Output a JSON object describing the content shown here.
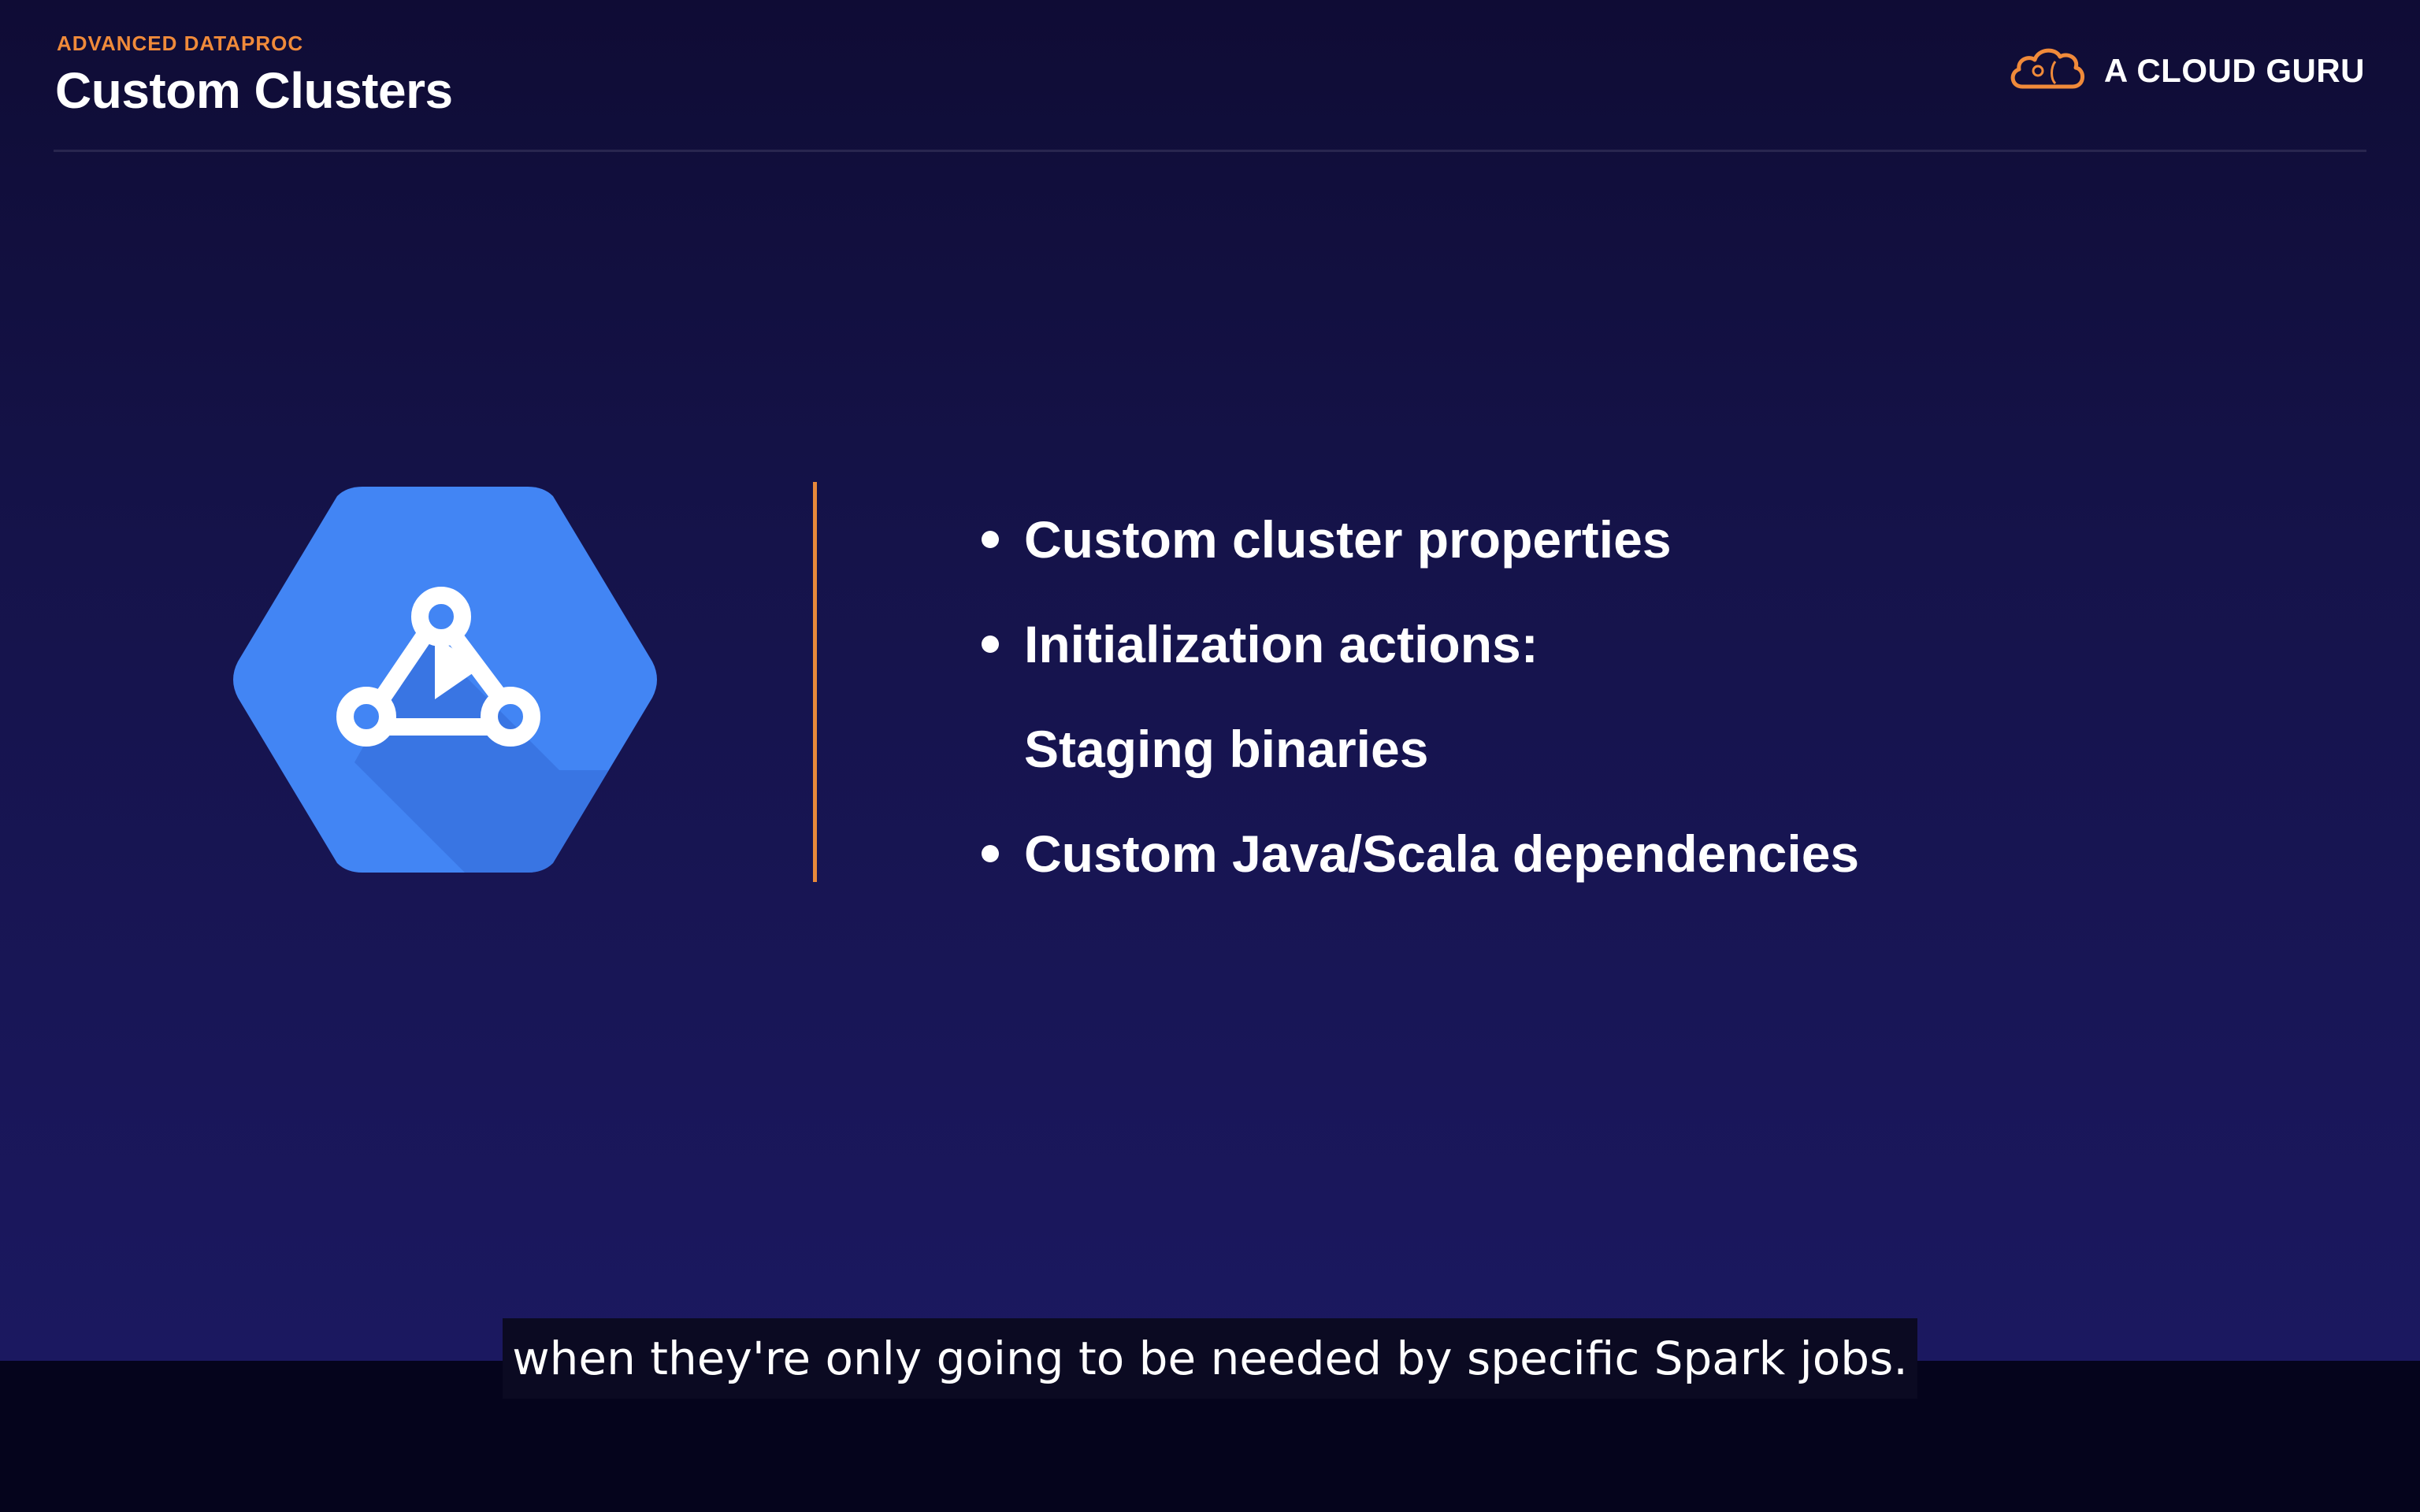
{
  "header": {
    "kicker": "ADVANCED DATAPROC",
    "title": "Custom Clusters"
  },
  "brand": {
    "name": "A CLOUD GURU",
    "icon": "cloud-guru-icon"
  },
  "product_icon": "dataproc-icon",
  "bullets": [
    "Custom cluster properties",
    "Initialization actions:",
    "Staging binaries",
    "Custom Java/Scala dependencies"
  ],
  "caption": "when they're only going to be needed by specific Spark jobs.",
  "colors": {
    "accent": "#f08a3a",
    "logo_blue": "#4285f4",
    "background": "#15134a"
  }
}
